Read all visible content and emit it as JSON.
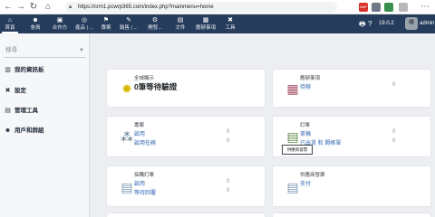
{
  "browser": {
    "url": "https://crm1.pcwrp365.com/index.php?mainmenu=home",
    "ext_badge": "ABP"
  },
  "topnav": {
    "items": [
      {
        "icon": "⌂",
        "label": "首頁"
      },
      {
        "icon": "☻",
        "label": "會員"
      },
      {
        "icon": "▣",
        "label": "合作方"
      },
      {
        "icon": "◎",
        "label": "產品 | ..."
      },
      {
        "icon": "⚑",
        "label": "專案"
      },
      {
        "icon": "✎",
        "label": "銷售 | ..."
      },
      {
        "icon": "⚙",
        "label": "開發..."
      },
      {
        "icon": "▤",
        "label": "文件"
      },
      {
        "icon": "▦",
        "label": "應辦事項"
      },
      {
        "icon": "✖",
        "label": "工具"
      }
    ],
    "version": "19.0.2",
    "username": "admin"
  },
  "sidebar": {
    "search_placeholder": "搜尋",
    "items": [
      {
        "icon": "▥",
        "label": "我的資訊板"
      },
      {
        "icon": "✖",
        "label": "設定"
      },
      {
        "icon": "▤",
        "label": "管理工具"
      },
      {
        "icon": "☻",
        "label": "用戶和群組"
      }
    ]
  },
  "cards": {
    "notify": {
      "title": "全域顯示",
      "big": "0筆等待驗證"
    },
    "todo": {
      "title": "應辦事項",
      "row1": "待辦",
      "val1": "0"
    },
    "project": {
      "title": "專案",
      "row1": "啟用",
      "val1": "0",
      "row2": "啟用任務",
      "val2": "0"
    },
    "order": {
      "title": "訂單",
      "row1": "草稿",
      "val1": "0",
      "row2": "已出貨 和 開帳單",
      "val2": "0"
    },
    "purchase": {
      "title": "採購訂單",
      "row1": "啟用",
      "val1": "0",
      "row2": "等待回覆",
      "val2": "0"
    },
    "invoice": {
      "title": "供應商發票",
      "row1": "支付",
      "tooltip": "供應商發票"
    }
  },
  "colors": {
    "nav_bg": "#263c5c",
    "link": "#2f67b3"
  }
}
